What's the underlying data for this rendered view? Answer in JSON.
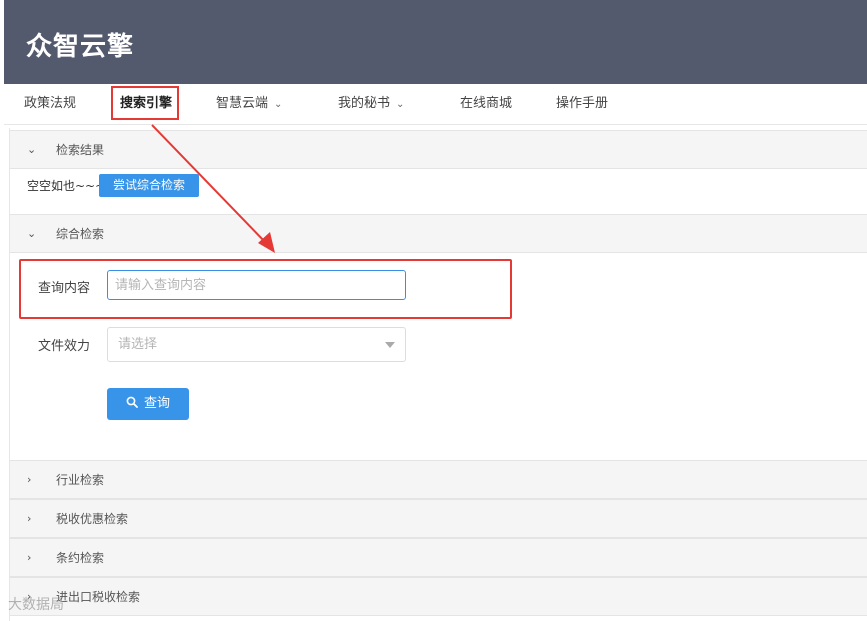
{
  "header": {
    "logo": "众智云擎"
  },
  "nav": {
    "items": [
      {
        "label": "政策法规"
      },
      {
        "label": "搜索引擎",
        "active": true
      },
      {
        "label": "智慧云端",
        "dropdown": true
      },
      {
        "label": "我的秘书",
        "dropdown": true
      },
      {
        "label": "在线商城"
      },
      {
        "label": "操作手册"
      }
    ]
  },
  "panels": {
    "results": {
      "label": "检索结果",
      "empty_text": "空空如也~~~",
      "try_button": "尝试综合检索"
    },
    "comprehensive": {
      "label": "综合检索",
      "query_label": "查询内容",
      "query_placeholder": "请输入查询内容",
      "effect_label": "文件效力",
      "effect_placeholder": "请选择",
      "submit_label": "查询"
    },
    "industry": {
      "label": "行业检索"
    },
    "tax_preference": {
      "label": "税收优惠检索"
    },
    "treaty": {
      "label": "条约检索"
    },
    "import_export": {
      "label": "进出口税收检索"
    }
  },
  "watermark": "大数据局",
  "colors": {
    "header_bg": "#535a6e",
    "accent": "#3794e8",
    "annotation": "#e53935"
  }
}
